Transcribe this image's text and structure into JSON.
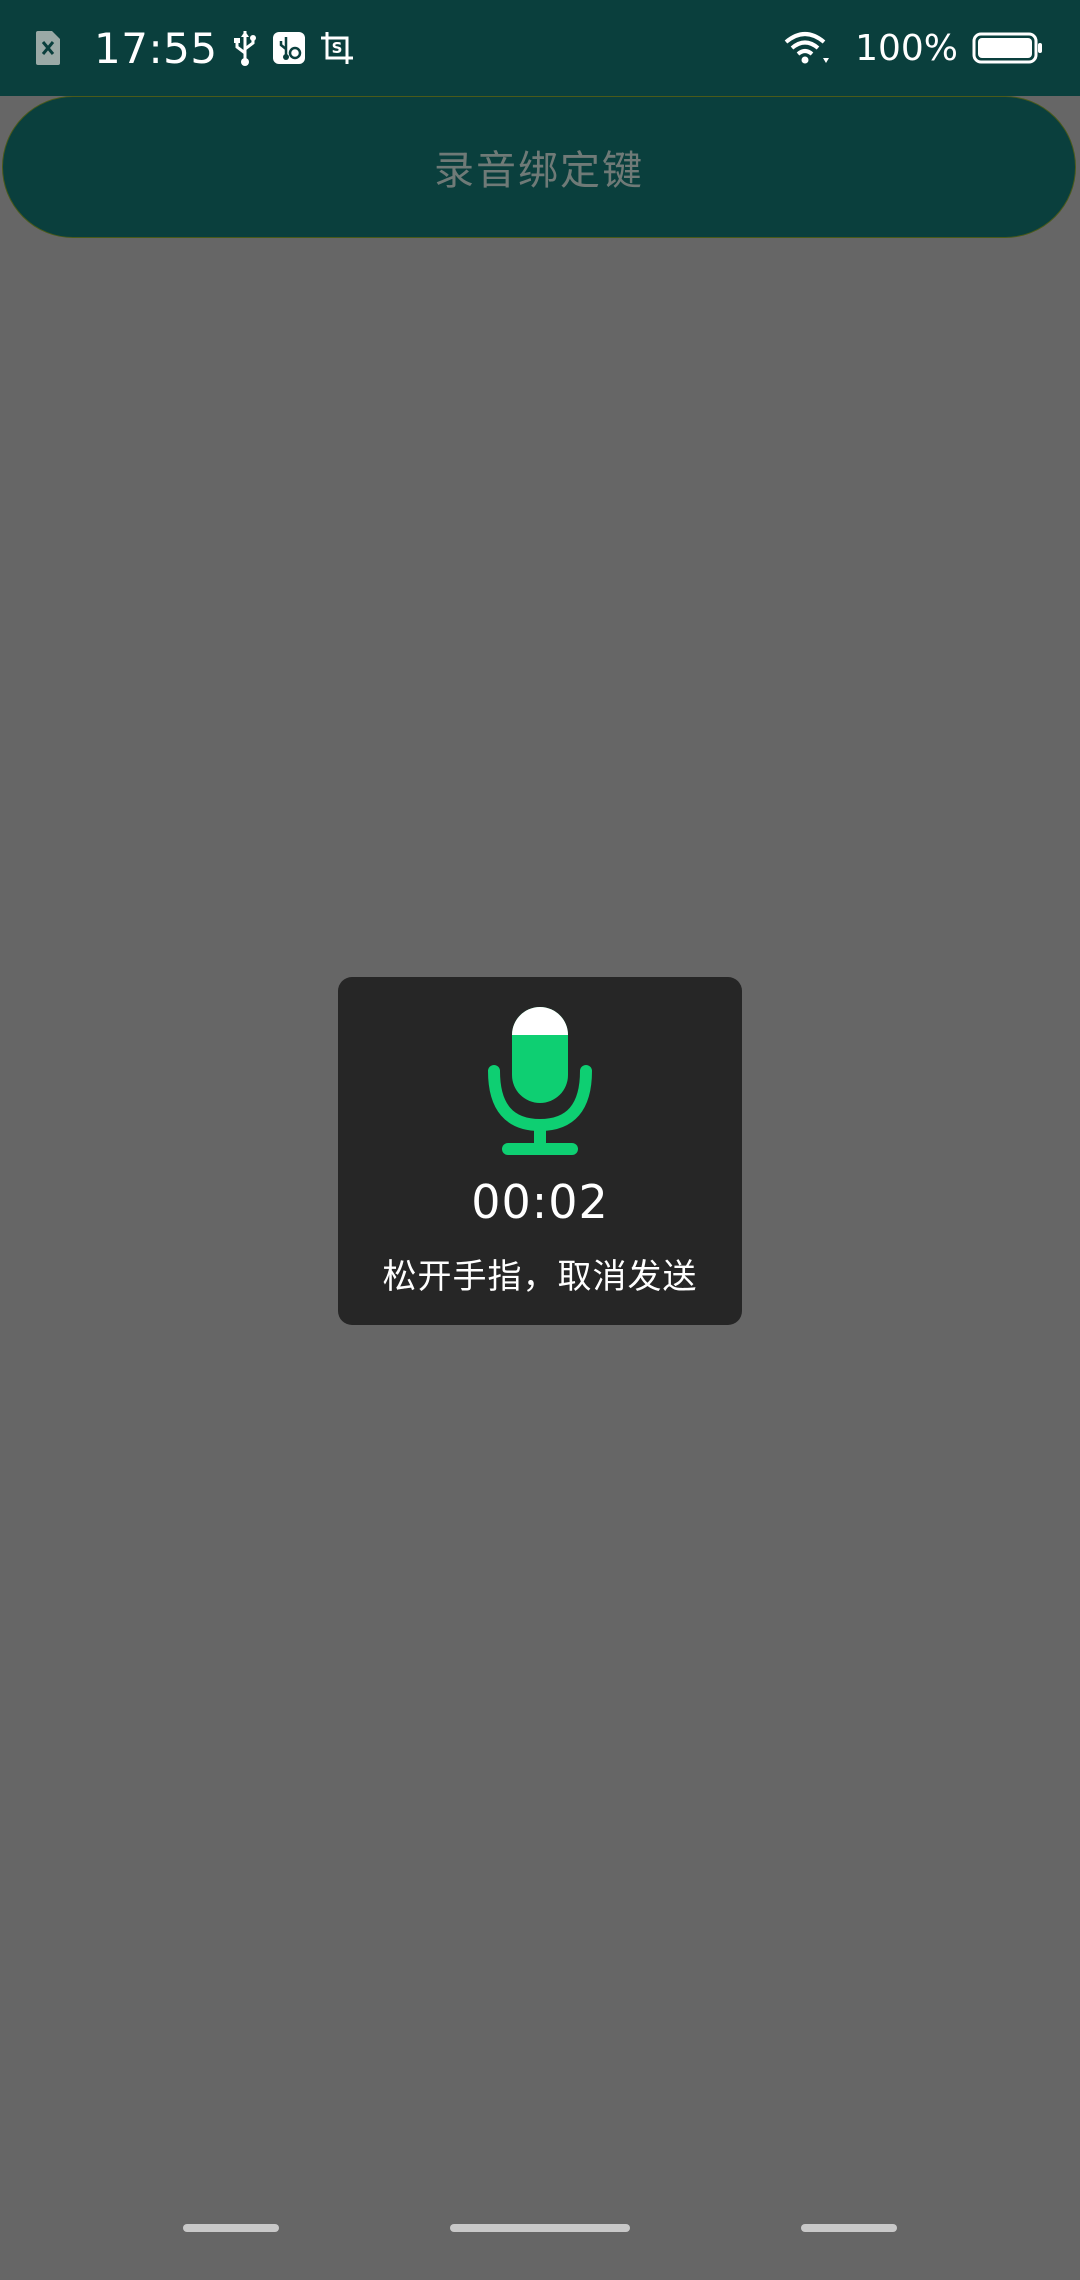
{
  "status_bar": {
    "time": "17:55",
    "battery_percent": "100%",
    "battery_level": 1.0,
    "icons_left": [
      "no-sim-icon",
      "usb-icon",
      "usb-debug-icon",
      "screenshot-icon"
    ],
    "icons_right": [
      "wifi-icon",
      "battery-icon"
    ]
  },
  "header_button": {
    "label": "录音绑定键"
  },
  "record_dialog": {
    "icon": "microphone-icon",
    "timer": "00:02",
    "hint": "松开手指，取消发送",
    "accent_color": "#0ecf72"
  },
  "colors": {
    "status_bar_bg": "#0a3f3d",
    "screen_bg": "#666666",
    "dialog_bg": "#262626"
  },
  "nav_bar": {
    "items": [
      "nav-back-pill",
      "nav-home-pill",
      "nav-recents-pill"
    ]
  }
}
